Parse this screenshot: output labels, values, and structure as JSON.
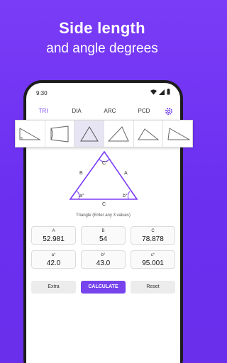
{
  "headline": {
    "line1": "Side length",
    "line2": "and angle degrees"
  },
  "statusbar": {
    "time": "9:30"
  },
  "tabs": [
    {
      "label": "TRI",
      "active": true
    },
    {
      "label": "DIA",
      "active": false
    },
    {
      "label": "ARC",
      "active": false
    },
    {
      "label": "PCD",
      "active": false
    }
  ],
  "settings_icon": "gear-icon",
  "shapes": [
    {
      "name": "right-triangle-icon",
      "selected": false
    },
    {
      "name": "trapezoid-icon",
      "selected": false
    },
    {
      "name": "equilateral-triangle-icon",
      "selected": true
    },
    {
      "name": "acute-triangle-icon",
      "selected": false
    },
    {
      "name": "obtuse-triangle-icon",
      "selected": false
    },
    {
      "name": "scalene-triangle-icon",
      "selected": false
    }
  ],
  "diagram": {
    "top_angle": "C°",
    "left_angle": "a°",
    "right_angle": "b°",
    "side_left": "B",
    "side_right": "A",
    "side_bottom": "C"
  },
  "caption": "Triangle (Enter any 3 values)",
  "sides": [
    {
      "label": "A",
      "value": "52.981"
    },
    {
      "label": "B",
      "value": "54"
    },
    {
      "label": "C",
      "value": "78.878"
    }
  ],
  "angles": [
    {
      "label": "a°",
      "value": "42.0"
    },
    {
      "label": "b°",
      "value": "43.0"
    },
    {
      "label": "c°",
      "value": "95.001"
    }
  ],
  "buttons": {
    "extra": "Extra",
    "calculate": "CALCULATE",
    "reset": "Reset"
  },
  "colors": {
    "accent": "#6d3ae6",
    "background": "#7a3cf6"
  }
}
